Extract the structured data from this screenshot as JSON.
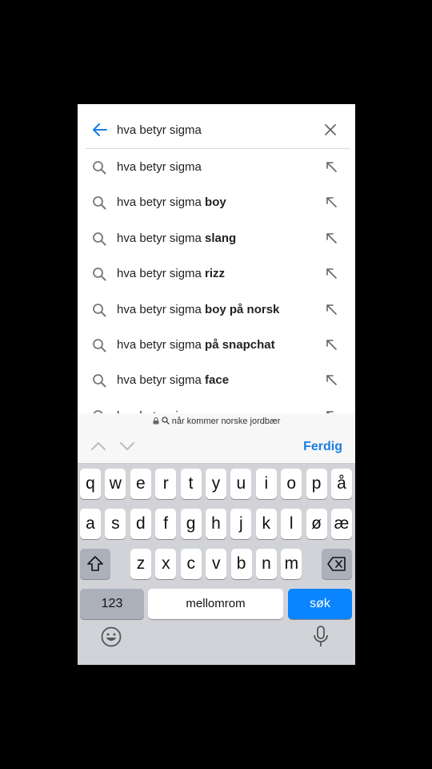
{
  "search": {
    "query": "hva betyr sigma"
  },
  "suggestions": [
    {
      "prefix": "hva betyr sigma",
      "bold": ""
    },
    {
      "prefix": "hva betyr sigma ",
      "bold": "boy"
    },
    {
      "prefix": "hva betyr sigma ",
      "bold": "slang"
    },
    {
      "prefix": "hva betyr sigma ",
      "bold": "rizz"
    },
    {
      "prefix": "hva betyr sigma ",
      "bold": "boy på norsk"
    },
    {
      "prefix": "hva betyr sigma ",
      "bold": "på snapchat"
    },
    {
      "prefix": "hva betyr sigma ",
      "bold": "face"
    },
    {
      "prefix": "hva betyr sigma ",
      "bold": ""
    }
  ],
  "quicktype": {
    "text": "når kommer norske jordbær"
  },
  "accessory": {
    "done_label": "Ferdig"
  },
  "keyboard": {
    "row1": [
      "q",
      "w",
      "e",
      "r",
      "t",
      "y",
      "u",
      "i",
      "o",
      "p",
      "å"
    ],
    "row2": [
      "a",
      "s",
      "d",
      "f",
      "g",
      "h",
      "j",
      "k",
      "l",
      "ø",
      "æ"
    ],
    "row3": [
      "z",
      "x",
      "c",
      "v",
      "b",
      "n",
      "m"
    ],
    "numbers_label": "123",
    "space_label": "mellomrom",
    "search_label": "søk"
  },
  "colors": {
    "accent": "#1a7fe0",
    "search_key": "#0a84ff",
    "keyboard_bg": "#d1d3d9"
  }
}
